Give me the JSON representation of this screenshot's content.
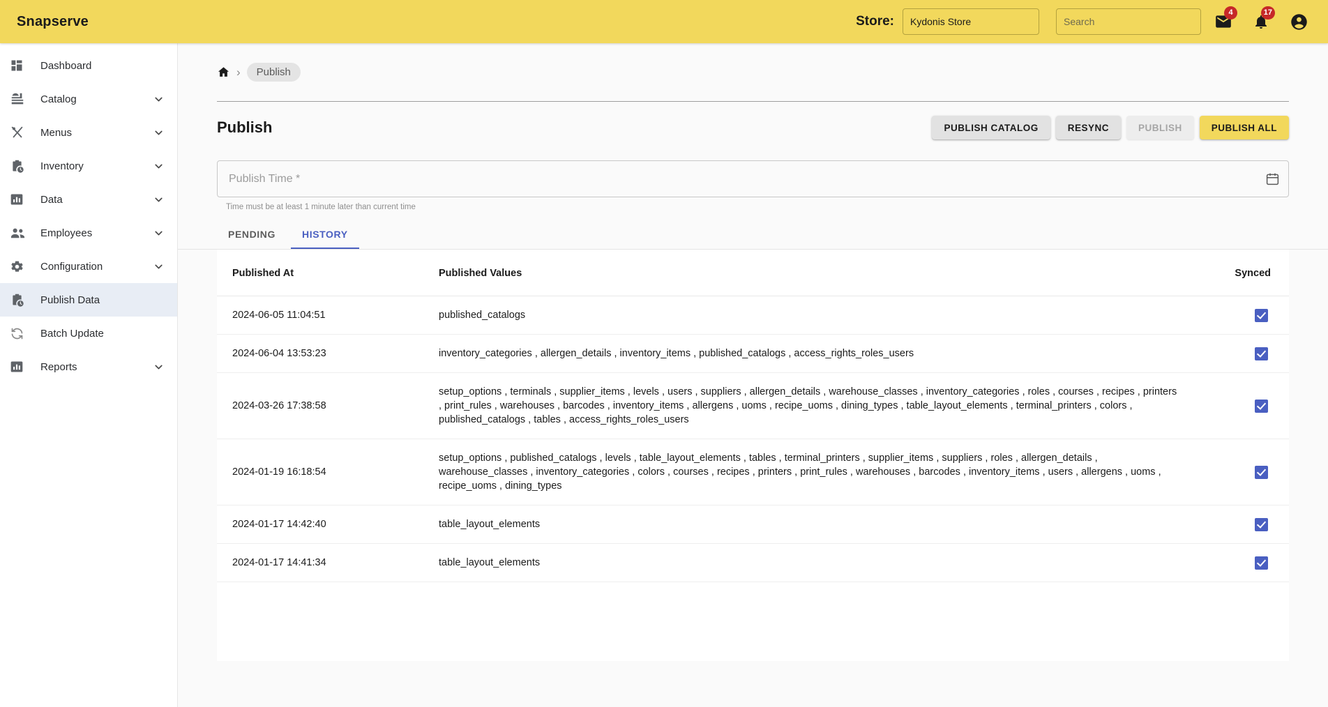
{
  "header": {
    "brand": "Snapserve",
    "store_label": "Store:",
    "store_value": "Kydonis Store",
    "search_placeholder": "Search",
    "mail_badge": "4",
    "bell_badge": "17"
  },
  "sidebar": {
    "items": [
      {
        "label": "Dashboard",
        "icon": "dashboard-icon",
        "expandable": false,
        "active": false
      },
      {
        "label": "Catalog",
        "icon": "catalog-icon",
        "expandable": true,
        "active": false
      },
      {
        "label": "Menus",
        "icon": "menus-icon",
        "expandable": true,
        "active": false
      },
      {
        "label": "Inventory",
        "icon": "inventory-icon",
        "expandable": true,
        "active": false
      },
      {
        "label": "Data",
        "icon": "data-icon",
        "expandable": true,
        "active": false
      },
      {
        "label": "Employees",
        "icon": "employees-icon",
        "expandable": true,
        "active": false
      },
      {
        "label": "Configuration",
        "icon": "gear-icon",
        "expandable": true,
        "active": false
      },
      {
        "label": "Publish Data",
        "icon": "publish-data-icon",
        "expandable": false,
        "active": true
      },
      {
        "label": "Batch Update",
        "icon": "sync-icon",
        "expandable": false,
        "active": false
      },
      {
        "label": "Reports",
        "icon": "reports-icon",
        "expandable": true,
        "active": false
      }
    ]
  },
  "breadcrumb": {
    "home_icon": "home-icon",
    "separator": "›",
    "current": "Publish"
  },
  "page": {
    "title": "Publish",
    "buttons": [
      {
        "label": "PUBLISH CATALOG",
        "state": "enabled"
      },
      {
        "label": "RESYNC",
        "state": "enabled"
      },
      {
        "label": "PUBLISH",
        "state": "disabled"
      },
      {
        "label": "PUBLISH ALL",
        "state": "primary"
      }
    ]
  },
  "publish_time": {
    "placeholder": "Publish Time *",
    "value": "",
    "helper": "Time must be at least 1 minute later than current time",
    "calendar_icon": "calendar-icon"
  },
  "tabs": [
    {
      "label": "PENDING",
      "active": false
    },
    {
      "label": "HISTORY",
      "active": true
    }
  ],
  "table": {
    "columns": [
      "Published At",
      "Published Values",
      "Synced"
    ],
    "rows": [
      {
        "published_at": "2024-06-05 11:04:51",
        "published_values": "published_catalogs",
        "synced": true
      },
      {
        "published_at": "2024-06-04 13:53:23",
        "published_values": "inventory_categories , allergen_details , inventory_items , published_catalogs , access_rights_roles_users",
        "synced": true
      },
      {
        "published_at": "2024-03-26 17:38:58",
        "published_values": "setup_options , terminals , supplier_items , levels , users , suppliers , allergen_details , warehouse_classes , inventory_categories , roles , courses , recipes , printers , print_rules , warehouses , barcodes , inventory_items , allergens , uoms , recipe_uoms , dining_types , table_layout_elements , terminal_printers , colors , published_catalogs , tables , access_rights_roles_users",
        "synced": true
      },
      {
        "published_at": "2024-01-19 16:18:54",
        "published_values": "setup_options , published_catalogs , levels , table_layout_elements , tables , terminal_printers , supplier_items , suppliers , roles , allergen_details , warehouse_classes , inventory_categories , colors , courses , recipes , printers , print_rules , warehouses , barcodes , inventory_items , users , allergens , uoms , recipe_uoms , dining_types",
        "synced": true
      },
      {
        "published_at": "2024-01-17 14:42:40",
        "published_values": "table_layout_elements",
        "synced": true
      },
      {
        "published_at": "2024-01-17 14:41:34",
        "published_values": "table_layout_elements",
        "synced": true
      }
    ]
  },
  "colors": {
    "brand_yellow": "#f2d85c",
    "accent_blue": "#4a5fc1",
    "badge_red": "#c62828",
    "active_nav": "#e8edf5"
  }
}
